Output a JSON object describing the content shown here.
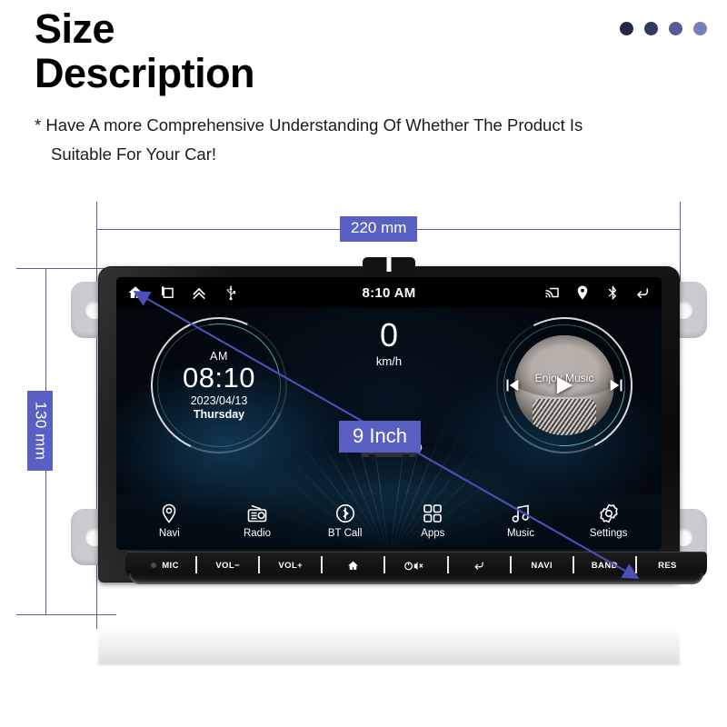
{
  "header": {
    "title_line1": "Size",
    "title_line2": "Description",
    "subtitle_line1": "* Have A more Comprehensive Understanding Of Whether The Product Is",
    "subtitle_line2": "Suitable For Your Car!",
    "dots": [
      "#23294a",
      "#333a61",
      "#555e94",
      "#7780bd"
    ]
  },
  "dimensions": {
    "width_label": "220 mm",
    "height_label": "130 mm",
    "diagonal_label": "9 Inch",
    "accent_color": "#5a5fc4",
    "line_color": "#5b6093"
  },
  "device": {
    "statusbar": {
      "time": "8:10 AM",
      "left_icons": [
        "home-icon",
        "recents-icon",
        "chevron-up-icon",
        "usb-icon"
      ],
      "right_icons": [
        "cast-icon",
        "location-pin-icon",
        "bluetooth-icon",
        "back-arrow-icon"
      ]
    },
    "clock_widget": {
      "ampm": "AM",
      "time": "08:10",
      "date": "2023/04/13",
      "weekday": "Thursday"
    },
    "speed_widget": {
      "value": "0",
      "unit": "km/h"
    },
    "music_widget": {
      "label": "Enjoy Music",
      "controls": [
        "previous-track-icon",
        "play-icon",
        "next-track-icon"
      ]
    },
    "dock": [
      {
        "label": "Navi",
        "icon": "location-pin-icon"
      },
      {
        "label": "Radio",
        "icon": "radio-icon"
      },
      {
        "label": "BT Call",
        "icon": "bluetooth-icon"
      },
      {
        "label": "Apps",
        "icon": "grid-apps-icon"
      },
      {
        "label": "Music",
        "icon": "music-note-icon"
      },
      {
        "label": "Settings",
        "icon": "gear-icon"
      }
    ],
    "hard_buttons": [
      {
        "label": "MIC",
        "icon": "mic-dot-icon"
      },
      {
        "label": "VOL−",
        "icon": ""
      },
      {
        "label": "VOL+",
        "icon": ""
      },
      {
        "label": "",
        "icon": "home-icon"
      },
      {
        "label": "",
        "icon": "power-mute-icon"
      },
      {
        "label": "",
        "icon": "back-arrow-icon"
      },
      {
        "label": "NAVI",
        "icon": ""
      },
      {
        "label": "BAND",
        "icon": ""
      },
      {
        "label": "RES",
        "icon": ""
      }
    ]
  }
}
